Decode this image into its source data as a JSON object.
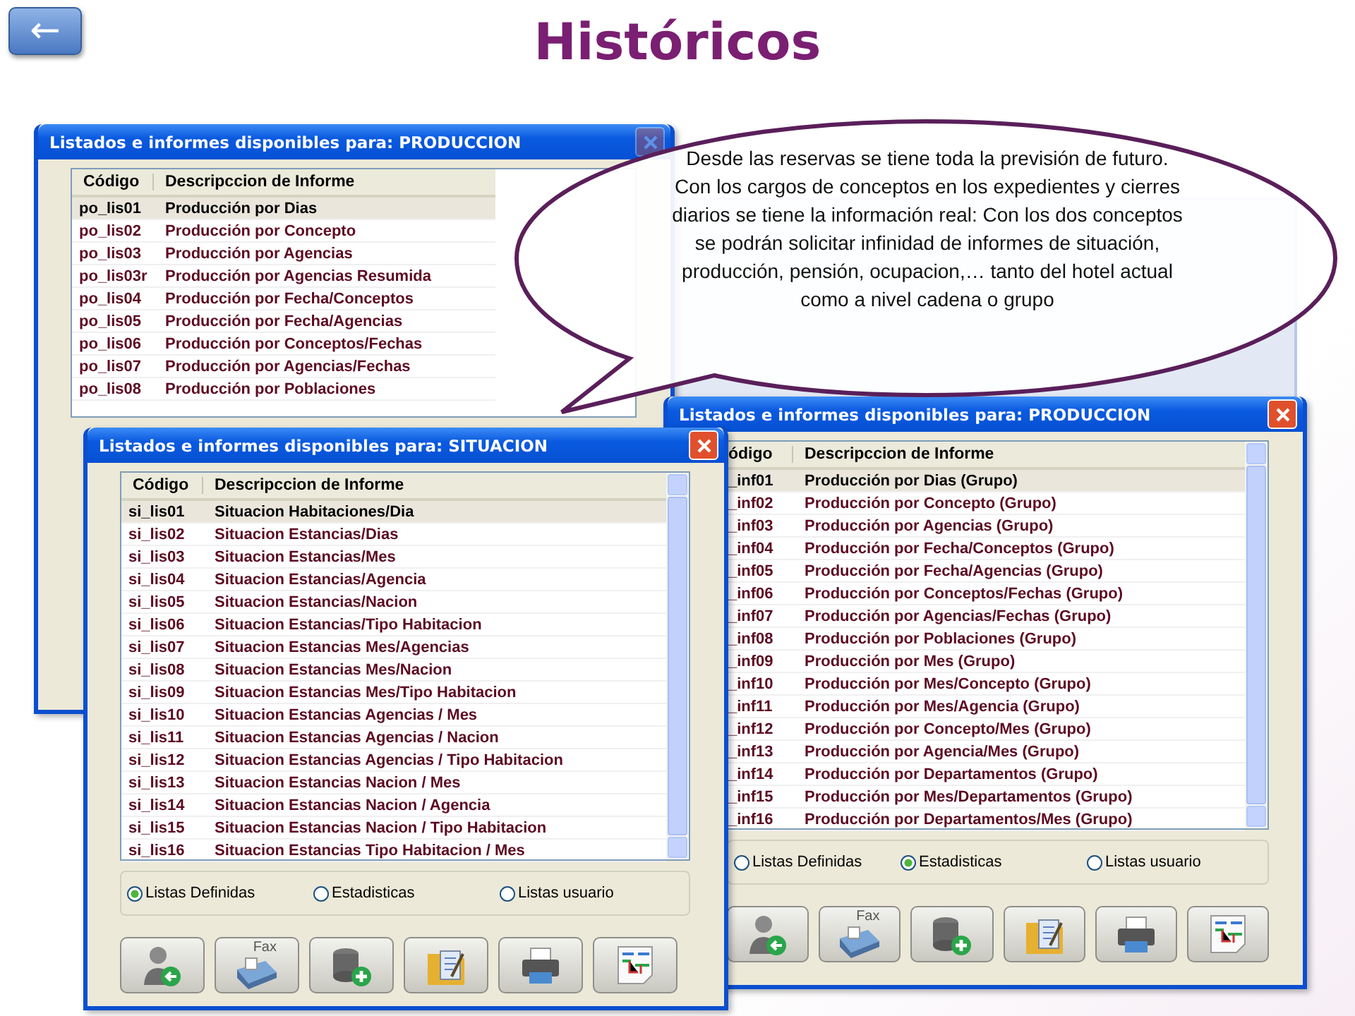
{
  "slide": {
    "title": "Históricos",
    "back_button": {
      "label": "←"
    }
  },
  "callout": {
    "text": "Desde las reservas se tiene toda la previsión de futuro. Con los cargos de conceptos en los expedientes y cierres diarios se tiene la información real: Con los dos conceptos se podrán solicitar infinidad de informes de situación, producción, pensión, ocupacion,… tanto del hotel actual como a nivel cadena o grupo"
  },
  "windows": [
    {
      "title": "Listados e informes disponibles para: PRODUCCION",
      "columns": [
        "Código",
        "Descripccion de Informe"
      ],
      "rows": [
        {
          "code": "po_lis01",
          "description": "Producción por Dias",
          "selected": true
        },
        {
          "code": "po_lis02",
          "description": "Producción por Concepto",
          "selected": false
        },
        {
          "code": "po_lis03",
          "description": "Producción por Agencias",
          "selected": false
        },
        {
          "code": "po_lis03r",
          "description": "Producción por Agencias Resumida",
          "selected": false
        },
        {
          "code": "po_lis04",
          "description": "Producción por Fecha/Conceptos",
          "selected": false
        },
        {
          "code": "po_lis05",
          "description": "Producción por Fecha/Agencias",
          "selected": false
        },
        {
          "code": "po_lis06",
          "description": "Producción por Conceptos/Fechas",
          "selected": false
        },
        {
          "code": "po_lis07",
          "description": "Producción por Agencias/Fechas",
          "selected": false
        },
        {
          "code": "po_lis08",
          "description": "Producción por Poblaciones",
          "selected": false
        }
      ]
    },
    {
      "title": "Listados e informes disponibles para: PRODUCCION",
      "columns": [
        "ódigo",
        "Descripccion de Informe"
      ],
      "rows": [
        {
          "code": "_inf01",
          "description": "Producción por Dias (Grupo)",
          "selected": true
        },
        {
          "code": "_inf02",
          "description": "Producción por Concepto (Grupo)",
          "selected": false
        },
        {
          "code": "_inf03",
          "description": "Producción por Agencias (Grupo)",
          "selected": false
        },
        {
          "code": "_inf04",
          "description": "Producción por Fecha/Conceptos (Grupo)",
          "selected": false
        },
        {
          "code": "_inf05",
          "description": "Producción por Fecha/Agencias (Grupo)",
          "selected": false
        },
        {
          "code": "_inf06",
          "description": "Producción por Conceptos/Fechas (Grupo)",
          "selected": false
        },
        {
          "code": "_inf07",
          "description": "Producción por Agencias/Fechas (Grupo)",
          "selected": false
        },
        {
          "code": "_inf08",
          "description": "Producción por Poblaciones (Grupo)",
          "selected": false
        },
        {
          "code": "_inf09",
          "description": "Producción por Mes (Grupo)",
          "selected": false
        },
        {
          "code": "_inf10",
          "description": "Producción por Mes/Concepto (Grupo)",
          "selected": false
        },
        {
          "code": "_inf11",
          "description": "Producción por Mes/Agencia (Grupo)",
          "selected": false
        },
        {
          "code": "_inf12",
          "description": "Producción por Concepto/Mes (Grupo)",
          "selected": false
        },
        {
          "code": "_inf13",
          "description": "Producción por Agencia/Mes (Grupo)",
          "selected": false
        },
        {
          "code": "_inf14",
          "description": "Producción por Departamentos (Grupo)",
          "selected": false
        },
        {
          "code": "_inf15",
          "description": "Producción por Mes/Departamentos (Grupo)",
          "selected": false
        },
        {
          "code": "_inf16",
          "description": "Producción por Departamentos/Mes (Grupo)",
          "selected": false
        }
      ],
      "radios": [
        {
          "label": "Listas Definidas",
          "selected": false
        },
        {
          "label": "Estadisticas",
          "selected": true
        },
        {
          "label": "Listas usuario",
          "selected": false
        }
      ],
      "buttons": [
        {
          "kind": "user"
        },
        {
          "kind": "fax",
          "label": "Fax"
        },
        {
          "kind": "database"
        },
        {
          "kind": "folder"
        },
        {
          "kind": "printer"
        },
        {
          "kind": "chart"
        }
      ]
    },
    {
      "title": "Listados e informes disponibles para: SITUACION",
      "columns": [
        "Código",
        "Descripccion de Informe"
      ],
      "rows": [
        {
          "code": "si_lis01",
          "description": "Situacion Habitaciones/Dia",
          "selected": true
        },
        {
          "code": "si_lis02",
          "description": "Situacion Estancias/Dias",
          "selected": false
        },
        {
          "code": "si_lis03",
          "description": "Situacion Estancias/Mes",
          "selected": false
        },
        {
          "code": "si_lis04",
          "description": "Situacion Estancias/Agencia",
          "selected": false
        },
        {
          "code": "si_lis05",
          "description": "Situacion Estancias/Nacion",
          "selected": false
        },
        {
          "code": "si_lis06",
          "description": "Situacion Estancias/Tipo Habitacion",
          "selected": false
        },
        {
          "code": "si_lis07",
          "description": "Situacion Estancias Mes/Agencias",
          "selected": false
        },
        {
          "code": "si_lis08",
          "description": "Situacion Estancias Mes/Nacion",
          "selected": false
        },
        {
          "code": "si_lis09",
          "description": "Situacion Estancias Mes/Tipo Habitacion",
          "selected": false
        },
        {
          "code": "si_lis10",
          "description": "Situacion Estancias Agencias / Mes",
          "selected": false
        },
        {
          "code": "si_lis11",
          "description": "Situacion Estancias Agencias / Nacion",
          "selected": false
        },
        {
          "code": "si_lis12",
          "description": "Situacion Estancias Agencias / Tipo Habitacion",
          "selected": false
        },
        {
          "code": "si_lis13",
          "description": "Situacion Estancias Nacion / Mes",
          "selected": false
        },
        {
          "code": "si_lis14",
          "description": "Situacion Estancias Nacion / Agencia",
          "selected": false
        },
        {
          "code": "si_lis15",
          "description": "Situacion Estancias Nacion / Tipo Habitacion",
          "selected": false
        },
        {
          "code": "si_lis16",
          "description": "Situacion Estancias Tipo Habitacion / Mes",
          "selected": false
        }
      ],
      "radios": [
        {
          "label": "Listas Definidas",
          "selected": true
        },
        {
          "label": "Estadisticas",
          "selected": false
        },
        {
          "label": "Listas usuario",
          "selected": false
        }
      ],
      "buttons": [
        {
          "kind": "user"
        },
        {
          "kind": "fax",
          "label": "Fax"
        },
        {
          "kind": "database"
        },
        {
          "kind": "folder"
        },
        {
          "kind": "printer"
        },
        {
          "kind": "chart"
        }
      ]
    }
  ]
}
